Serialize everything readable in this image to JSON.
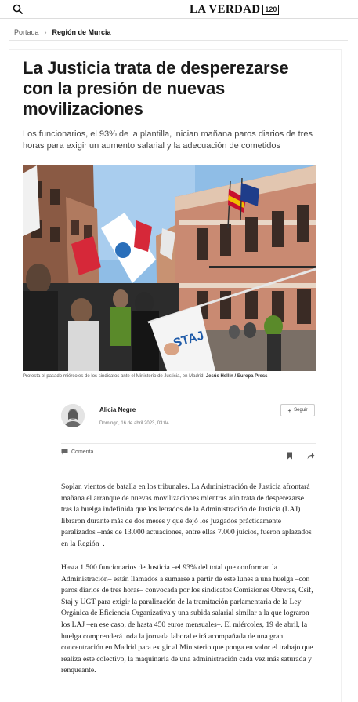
{
  "header": {
    "logo_text": "LA VERDAD",
    "logo_badge": "120",
    "search_icon": "search-icon"
  },
  "breadcrumb": {
    "home": "Portada",
    "separator": "›",
    "current": "Región de Murcia"
  },
  "article": {
    "headline": "La Justicia trata de desperezarse con la presión de nuevas movilizaciones",
    "subtitle": "Los funcionarios, el 93% de la plantilla, inician mañana paros diarios de tres horas para exigir un aumento salarial y la adecuación de cometidos",
    "photo": {
      "banner_text": "STAJ",
      "caption": "Protesta el pasado miércoles de los sindicatos ante el Ministerio de Justicia, en Madrid.",
      "credit": "Jesús Hellín / Europa Press"
    },
    "author": {
      "name": "Alicia Negre",
      "date": "Domingo, 16 de abril 2023, 03:04",
      "follow_label": "Seguir",
      "follow_icon": "plus-icon"
    },
    "actions": {
      "comment_label": "Comenta",
      "comment_icon": "comment-icon",
      "bookmark_icon": "bookmark-icon",
      "share_icon": "share-icon"
    },
    "paragraphs": [
      "Soplan vientos de batalla en los tribunales. La Administración de Justicia afrontará mañana el arranque de nuevas movilizaciones mientras aún trata de desperezarse tras la huelga indefinida que los letrados de la Administración de Justicia (LAJ) libraron durante más de dos meses y que dejó los juzgados prácticamente paralizados –más de 13.000 actuaciones, entre ellas 7.000 juicios, fueron aplazados en la Región–.",
      "Hasta 1.500 funcionarios de Justicia –el 93% del total que conforman la Administración– están llamados a sumarse a partir de este lunes a una huelga –con paros diarios de tres horas– convocada por los sindicatos Comisiones Obreras, Csif, Staj y UGT para exigir la paralización de la tramitación parlamentaria de la Ley Orgánica de Eficiencia Organizativa y una subida salarial similar a la que lograron los LAJ –en ese caso, de hasta 450 euros mensuales–. El miércoles, 19 de abril, la huelga comprenderá toda la jornada laboral e irá acompañada de una gran concentración en Madrid para exigir al Ministerio que ponga en valor el trabajo que realiza este colectivo, la maquinaria de una administración cada vez más saturada y renqueante."
    ]
  },
  "colors": {
    "text": "#222222",
    "muted": "#777777",
    "sky": "#7fb3e0",
    "brick": "#c98a72"
  }
}
